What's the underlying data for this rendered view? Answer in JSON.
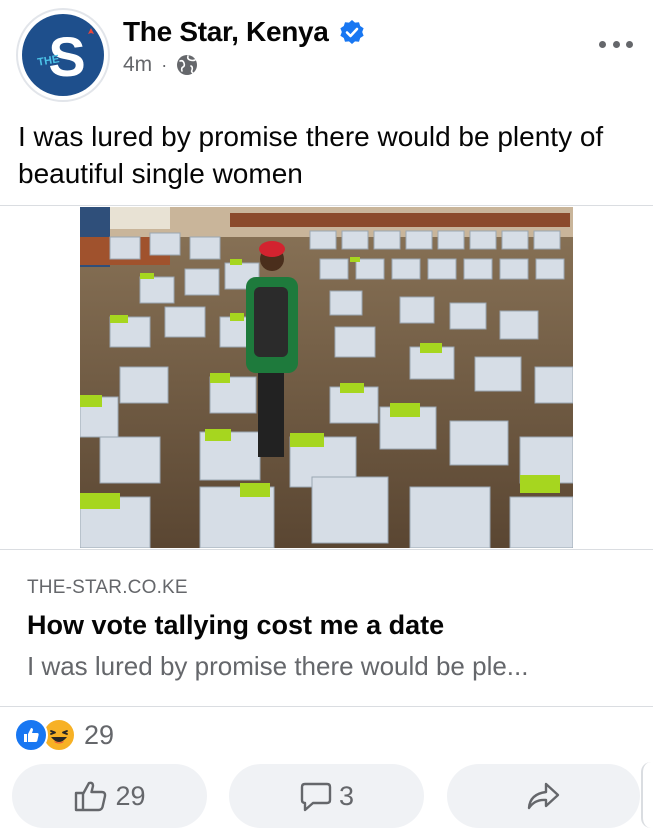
{
  "post": {
    "page_name": "The Star, Kenya",
    "verified_icon": "verified-badge-icon",
    "timestamp": "4m",
    "separator": "·",
    "audience_icon": "globe-icon",
    "more_icon": "more-options-icon",
    "text": "I was lured by promise there would be plenty of beautiful single women",
    "avatar": {
      "letter": "S",
      "tag": "THE"
    }
  },
  "link_preview": {
    "domain": "THE-STAR.CO.KE",
    "title": "How vote tallying cost me a date",
    "description": "I was lured by promise there would be ple..."
  },
  "reactions": {
    "types": [
      "like",
      "haha"
    ],
    "count": "29"
  },
  "actions": {
    "like_count": "29",
    "comment_count": "3",
    "share_icon": "share-icon"
  },
  "colors": {
    "facebook_blue": "#1877f2",
    "avatar_blue": "#1e4f8c",
    "secondary_text": "#65676b",
    "pill_bg": "#f0f2f5",
    "haha_yellow": "#f7b125"
  }
}
